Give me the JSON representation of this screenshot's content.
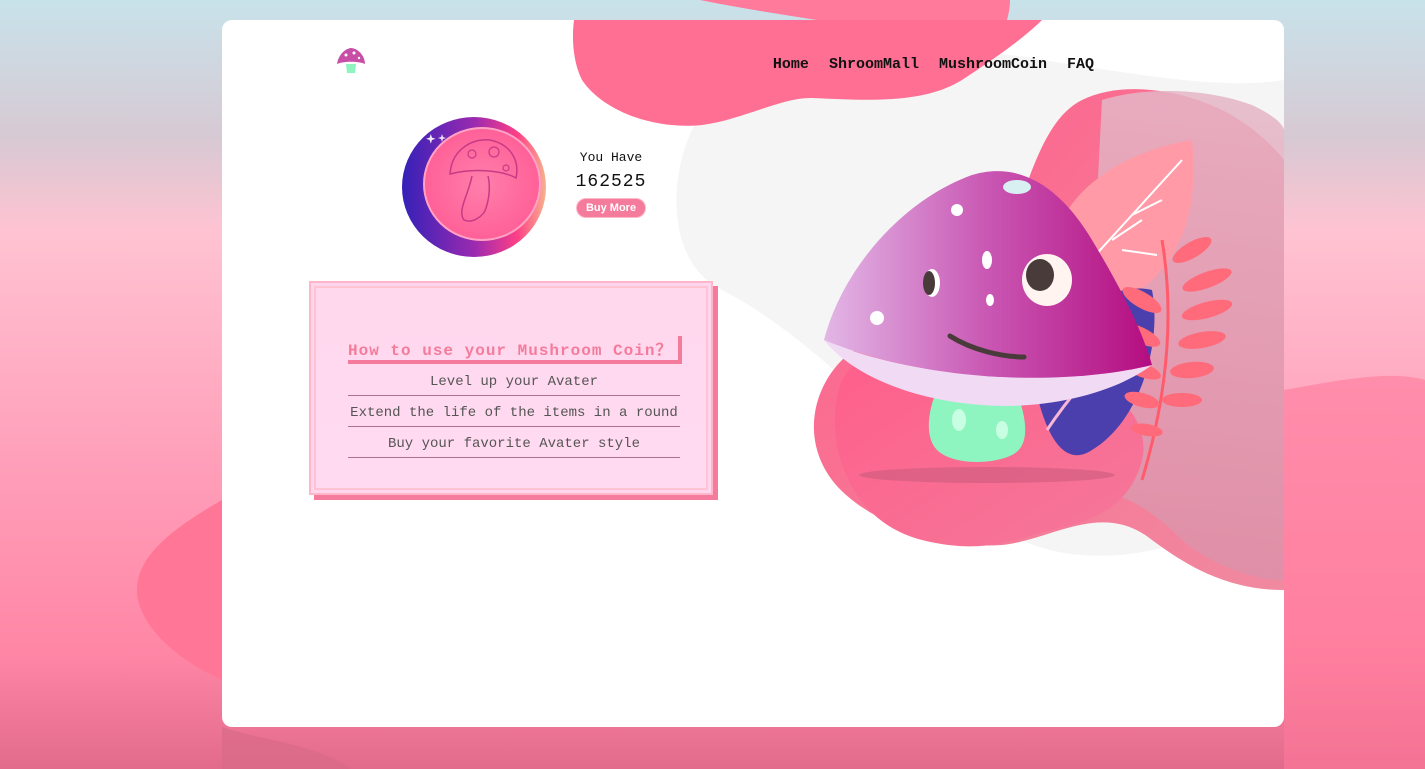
{
  "nav": {
    "items": [
      "Home",
      "ShroomMall",
      "MushroomCoin",
      "FAQ"
    ]
  },
  "balance": {
    "label": "You Have",
    "amount": "162525",
    "buy_label": "Buy More"
  },
  "info": {
    "title": "How to use your Mushroom Coin？",
    "items": [
      "Level up your Avater",
      "Extend the life of the items in a round",
      "Buy your favorite Avater style"
    ]
  },
  "colors": {
    "accent": "#f47b9b",
    "pink": "#ff7697",
    "purple": "#b54aa6",
    "mint": "#8ff5c0"
  }
}
